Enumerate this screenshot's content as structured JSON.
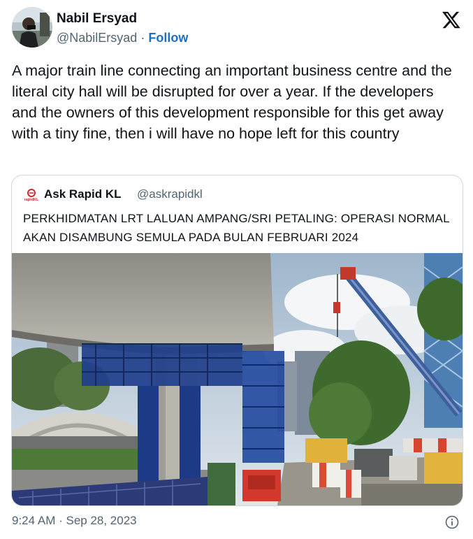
{
  "author": {
    "name": "Nabil Ersyad",
    "handle": "@NabilErsyad",
    "separator": "·",
    "follow_label": "Follow"
  },
  "tweet": {
    "text": "A major train line connecting an important business centre and the literal city hall will be disrupted for over a year. If the developers and the owners of this development responsible for this get away with a tiny fine, then i will have no hope left for this country"
  },
  "quoted": {
    "name": "Ask Rapid KL",
    "handle": "@askrapidkl",
    "logo_text": "rapidKL",
    "text": "PERKHIDMATAN LRT LALUAN AMPANG/SRI PETALING: OPERASI NORMAL AKAN DISAMBUNG SEMULA PADA BULAN FEBRUARI 2024",
    "photo_alt": "Elevated LRT track construction with blue scaffolding and a crane"
  },
  "footer": {
    "timestamp": "9:24 AM · Sep 28, 2023"
  },
  "icons": {
    "x_logo": "x-logo-icon",
    "info": "info-icon"
  },
  "colors": {
    "text": "#0f1419",
    "muted": "#536471",
    "follow": "#1d6fc7",
    "border": "#cfd9de"
  }
}
